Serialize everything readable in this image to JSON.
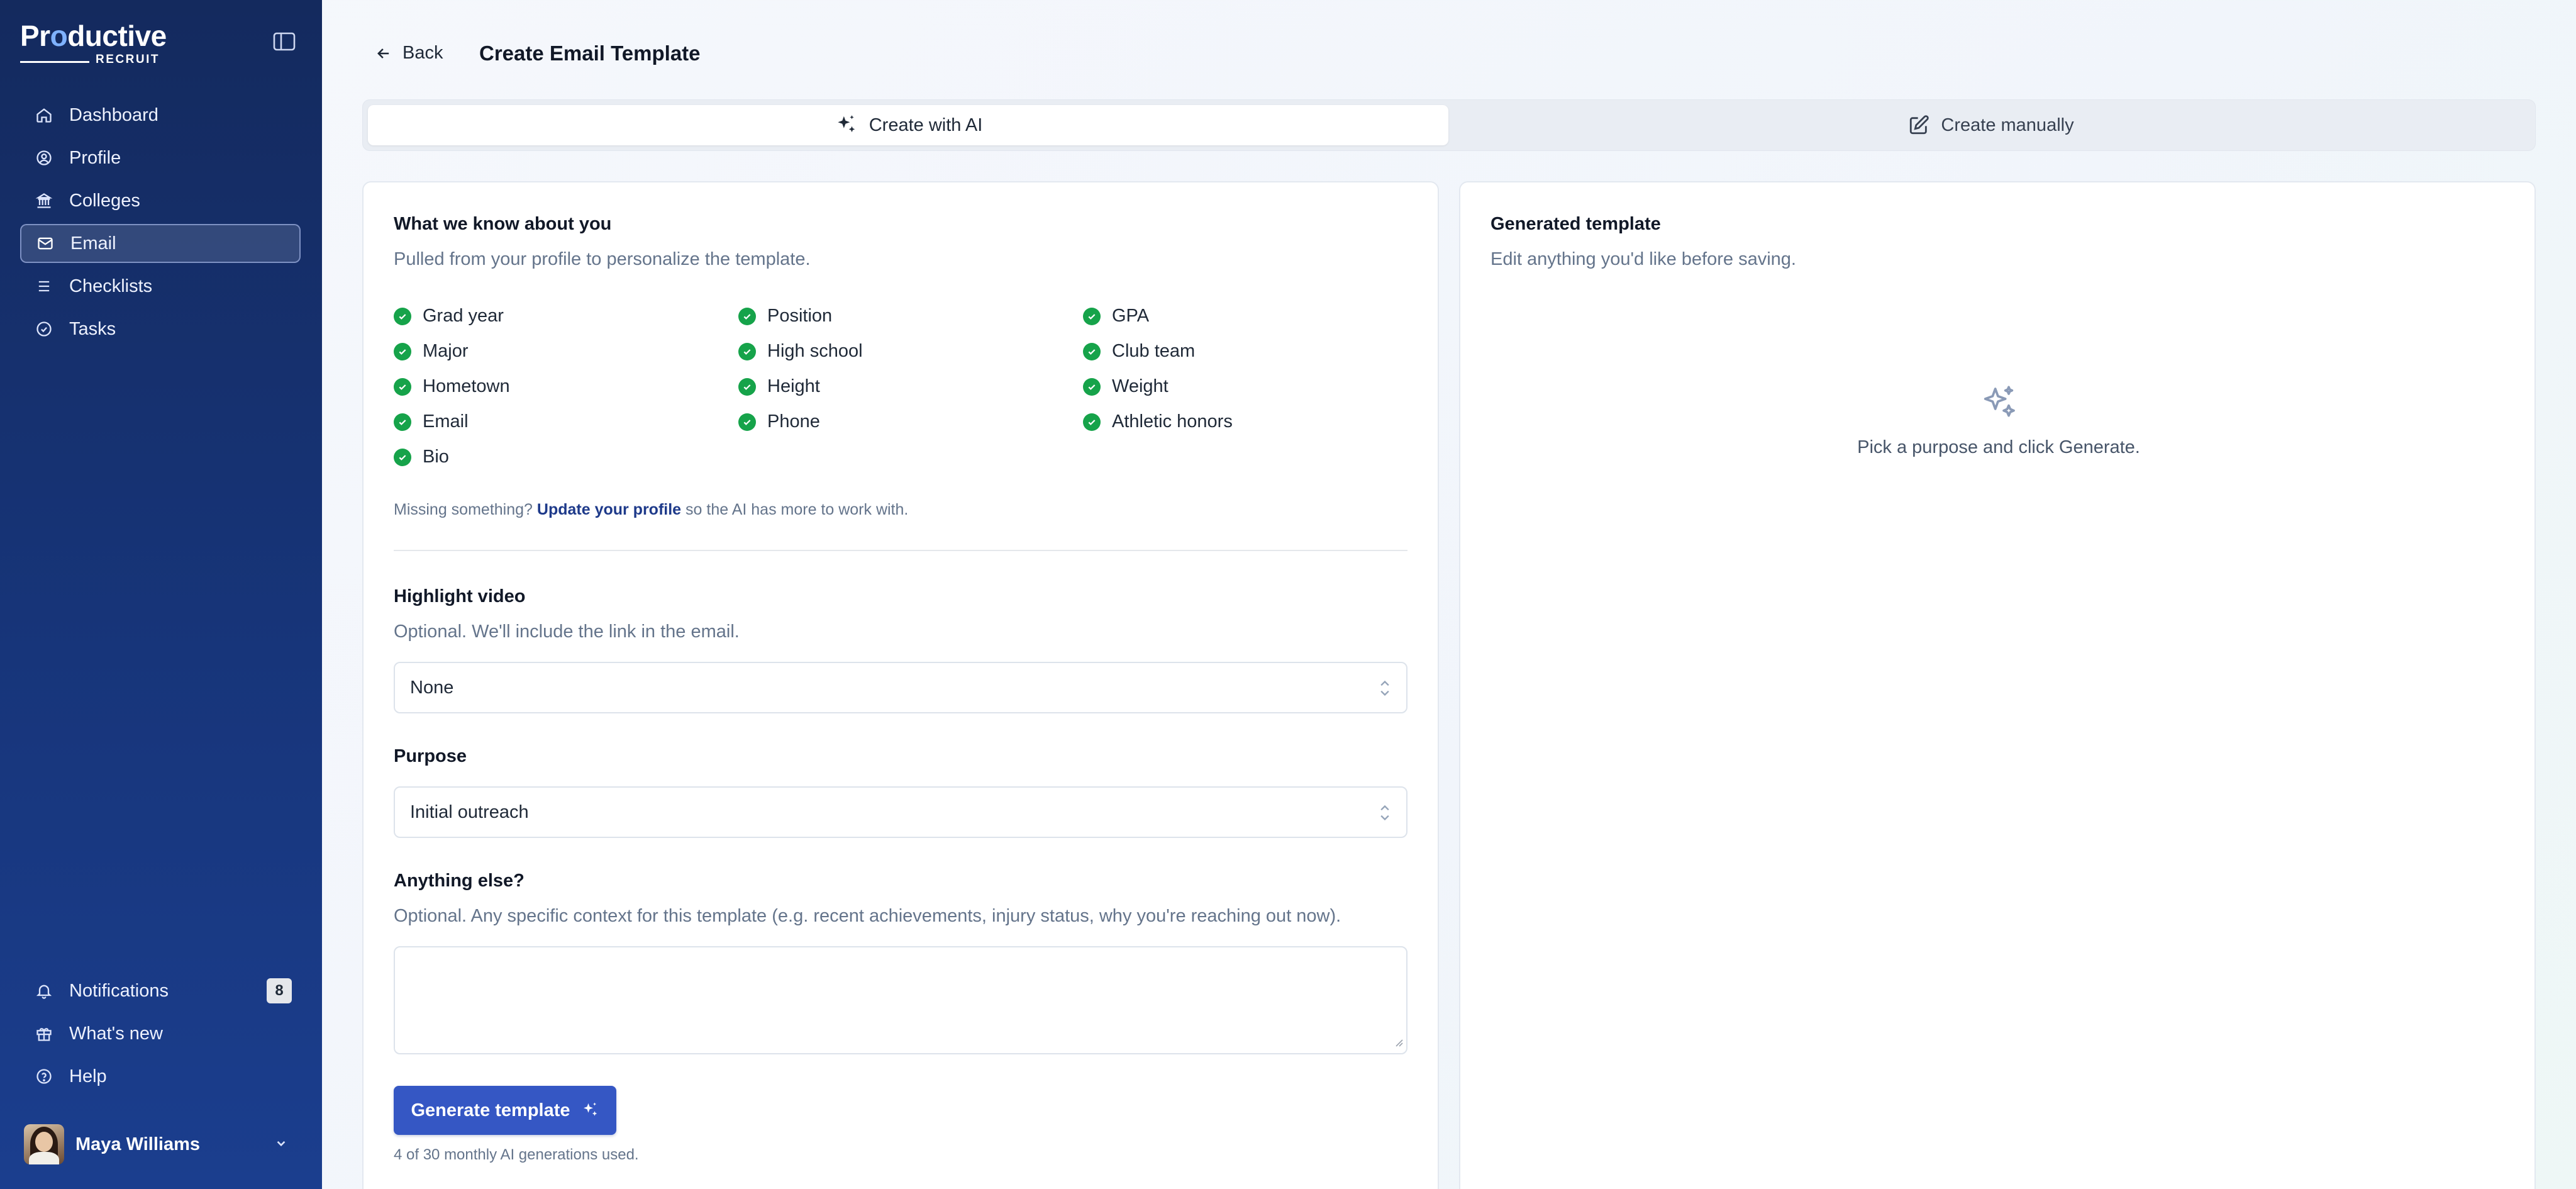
{
  "app": {
    "logo_main_pre": "Pr",
    "logo_main_o": "o",
    "logo_main_post": "ductive",
    "logo_sub": "RECRUIT"
  },
  "sidebar": {
    "items": [
      {
        "label": "Dashboard",
        "icon": "home-icon"
      },
      {
        "label": "Profile",
        "icon": "user-circle-icon"
      },
      {
        "label": "Colleges",
        "icon": "building-icon"
      },
      {
        "label": "Email",
        "icon": "mail-icon",
        "active": true
      },
      {
        "label": "Checklists",
        "icon": "list-icon"
      },
      {
        "label": "Tasks",
        "icon": "check-circle-icon"
      }
    ],
    "bottom": [
      {
        "label": "Notifications",
        "icon": "bell-icon",
        "badge": "8"
      },
      {
        "label": "What's new",
        "icon": "gift-icon"
      },
      {
        "label": "Help",
        "icon": "help-circle-icon"
      }
    ],
    "user_name": "Maya Williams"
  },
  "header": {
    "back_label": "Back",
    "title": "Create Email Template"
  },
  "modes": {
    "ai_label": "Create with AI",
    "manual_label": "Create manually"
  },
  "about": {
    "title": "What we know about you",
    "subtitle": "Pulled from your profile to personalize the template.",
    "fields": [
      "Grad year",
      "Position",
      "GPA",
      "Major",
      "High school",
      "Club team",
      "Hometown",
      "Height",
      "Weight",
      "Email",
      "Phone",
      "Athletic honors",
      "Bio"
    ],
    "missing_pre": "Missing something?",
    "missing_link": "Update your profile",
    "missing_post": "so the AI has more to work with."
  },
  "video": {
    "title": "Highlight video",
    "subtitle": "Optional. We'll include the link in the email.",
    "value": "None"
  },
  "purpose": {
    "title": "Purpose",
    "value": "Initial outreach"
  },
  "context": {
    "title": "Anything else?",
    "subtitle": "Optional. Any specific context for this template (e.g. recent achievements, injury status, why you're reaching out now).",
    "value": ""
  },
  "generate": {
    "label": "Generate template",
    "usage": "4 of 30 monthly AI generations used."
  },
  "preview": {
    "title": "Generated template",
    "subtitle": "Edit anything you'd like before saving.",
    "empty": "Pick a purpose and click Generate."
  },
  "colors": {
    "sidebar": "#17357a",
    "accent": "#3557c4",
    "check": "#16a34a"
  }
}
